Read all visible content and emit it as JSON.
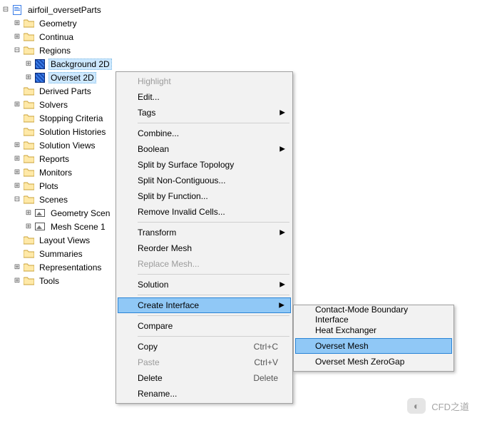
{
  "tree": {
    "root": "airfoil_oversetParts",
    "items": [
      {
        "label": "Geometry",
        "depth": 1,
        "toggle": "plus",
        "icon": "folder"
      },
      {
        "label": "Continua",
        "depth": 1,
        "toggle": "plus",
        "icon": "folder"
      },
      {
        "label": "Regions",
        "depth": 1,
        "toggle": "minus",
        "icon": "folder"
      },
      {
        "label": "Background 2D",
        "depth": 2,
        "toggle": "plus",
        "icon": "mesh",
        "selected": true
      },
      {
        "label": "Overset 2D",
        "depth": 2,
        "toggle": "plus",
        "icon": "mesh",
        "selected": true
      },
      {
        "label": "Derived Parts",
        "depth": 1,
        "toggle": "none",
        "icon": "folder"
      },
      {
        "label": "Solvers",
        "depth": 1,
        "toggle": "plus",
        "icon": "folder"
      },
      {
        "label": "Stopping Criteria",
        "depth": 1,
        "toggle": "none",
        "icon": "folder"
      },
      {
        "label": "Solution Histories",
        "depth": 1,
        "toggle": "none",
        "icon": "folder"
      },
      {
        "label": "Solution Views",
        "depth": 1,
        "toggle": "plus",
        "icon": "folder"
      },
      {
        "label": "Reports",
        "depth": 1,
        "toggle": "plus",
        "icon": "folder"
      },
      {
        "label": "Monitors",
        "depth": 1,
        "toggle": "plus",
        "icon": "folder"
      },
      {
        "label": "Plots",
        "depth": 1,
        "toggle": "plus",
        "icon": "folder"
      },
      {
        "label": "Scenes",
        "depth": 1,
        "toggle": "minus",
        "icon": "folder"
      },
      {
        "label": "Geometry Scen",
        "depth": 2,
        "toggle": "plus",
        "icon": "scene"
      },
      {
        "label": "Mesh Scene 1",
        "depth": 2,
        "toggle": "plus",
        "icon": "scene"
      },
      {
        "label": "Layout Views",
        "depth": 1,
        "toggle": "none",
        "icon": "folder"
      },
      {
        "label": "Summaries",
        "depth": 1,
        "toggle": "none",
        "icon": "folder"
      },
      {
        "label": "Representations",
        "depth": 1,
        "toggle": "plus",
        "icon": "folder"
      },
      {
        "label": "Tools",
        "depth": 1,
        "toggle": "plus",
        "icon": "folder"
      }
    ]
  },
  "menu": {
    "items": [
      {
        "label": "Highlight",
        "disabled": true
      },
      {
        "label": "Edit..."
      },
      {
        "label": "Tags",
        "submenu": true
      },
      {
        "sep": true
      },
      {
        "label": "Combine..."
      },
      {
        "label": "Boolean",
        "submenu": true
      },
      {
        "label": "Split by Surface Topology"
      },
      {
        "label": "Split Non-Contiguous..."
      },
      {
        "label": "Split by Function..."
      },
      {
        "label": "Remove Invalid Cells..."
      },
      {
        "sep": true
      },
      {
        "label": "Transform",
        "submenu": true
      },
      {
        "label": "Reorder Mesh"
      },
      {
        "label": "Replace Mesh...",
        "disabled": true
      },
      {
        "sep": true
      },
      {
        "label": "Solution",
        "submenu": true
      },
      {
        "sep": true
      },
      {
        "label": "Create Interface",
        "submenu": true,
        "highlight": true
      },
      {
        "sep": true
      },
      {
        "label": "Compare"
      },
      {
        "sep": true
      },
      {
        "label": "Copy",
        "shortcut": "Ctrl+C"
      },
      {
        "label": "Paste",
        "shortcut": "Ctrl+V",
        "disabled": true
      },
      {
        "label": "Delete",
        "shortcut": "Delete"
      },
      {
        "label": "Rename..."
      }
    ]
  },
  "submenu": {
    "items": [
      {
        "label": "Contact-Mode Boundary Interface"
      },
      {
        "label": "Heat Exchanger"
      },
      {
        "label": "Overset Mesh",
        "highlight": true
      },
      {
        "label": "Overset Mesh ZeroGap"
      }
    ]
  },
  "watermark": "CFD之道"
}
